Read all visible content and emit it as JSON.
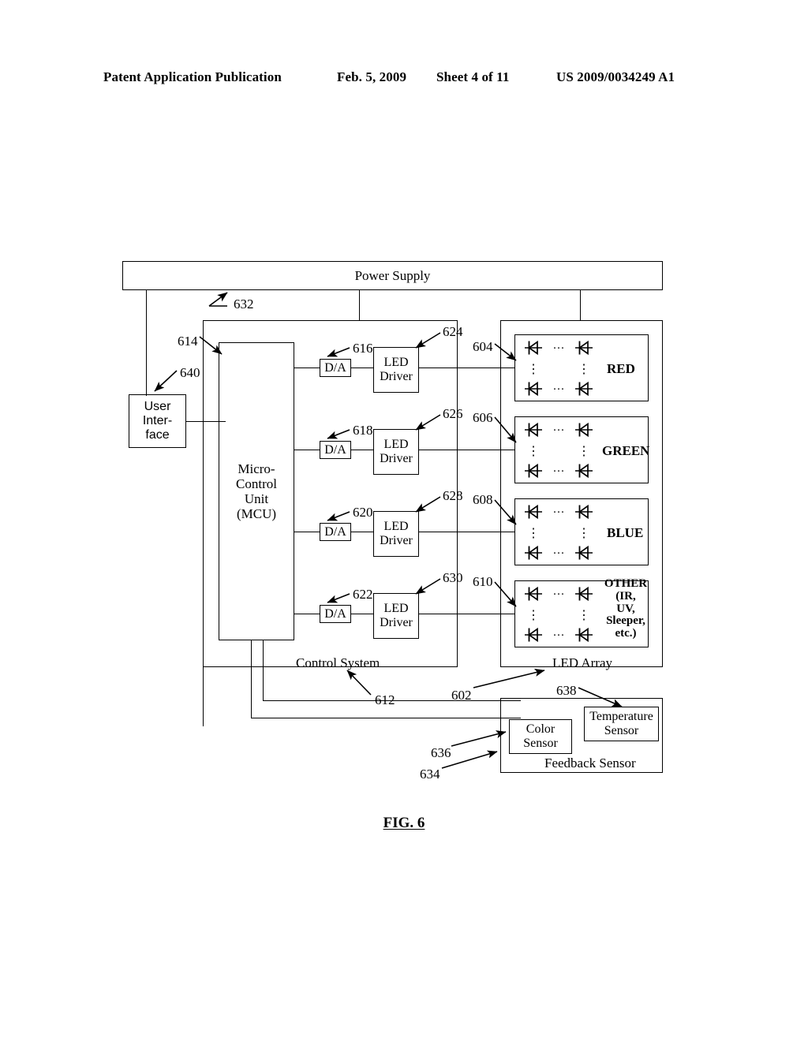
{
  "header": {
    "publication": "Patent Application Publication",
    "date": "Feb. 5, 2009",
    "sheet": "Sheet 4 of 11",
    "docnum": "US 2009/0034249 A1"
  },
  "figure": {
    "caption": "FIG. 6"
  },
  "blocks": {
    "power_supply": "Power Supply",
    "user_interface": "User\nInter-\nface",
    "mcu": "Micro-\nControl\nUnit\n(MCU)",
    "control_system": "Control System",
    "led_array": "LED Array",
    "feedback_sensor": "Feedback Sensor",
    "color_sensor": "Color\nSensor",
    "temperature_sensor": "Temperature\nSensor",
    "da": "D/A",
    "led_driver": "LED\nDriver"
  },
  "da_units": [
    {
      "label": "D/A",
      "ref": "616"
    },
    {
      "label": "D/A",
      "ref": "618"
    },
    {
      "label": "D/A",
      "ref": "620"
    },
    {
      "label": "D/A",
      "ref": "622"
    }
  ],
  "led_drivers": [
    {
      "label": "LED\nDriver",
      "ref": "624"
    },
    {
      "label": "LED\nDriver",
      "ref": "626"
    },
    {
      "label": "LED\nDriver",
      "ref": "628"
    },
    {
      "label": "LED\nDriver",
      "ref": "630"
    }
  ],
  "led_groups": [
    {
      "label": "RED",
      "ref": "604"
    },
    {
      "label": "GREEN",
      "ref": "606"
    },
    {
      "label": "BLUE",
      "ref": "608"
    },
    {
      "label": "OTHER\n(IR,\nUV,\nSleeper,\netc.)",
      "ref": "610"
    }
  ],
  "refs": {
    "power_supply": "632",
    "mcu": "614",
    "user_interface": "640",
    "control_system": "612",
    "led_array": "602",
    "temperature_sensor": "638",
    "color_sensor": "636",
    "feedback_sensor": "634"
  },
  "icons": {
    "diode": "diode-symbol",
    "ellipsis_h": "···",
    "ellipsis_v": "⋮"
  },
  "colors": {
    "ink": "#000000",
    "paper": "#ffffff"
  }
}
